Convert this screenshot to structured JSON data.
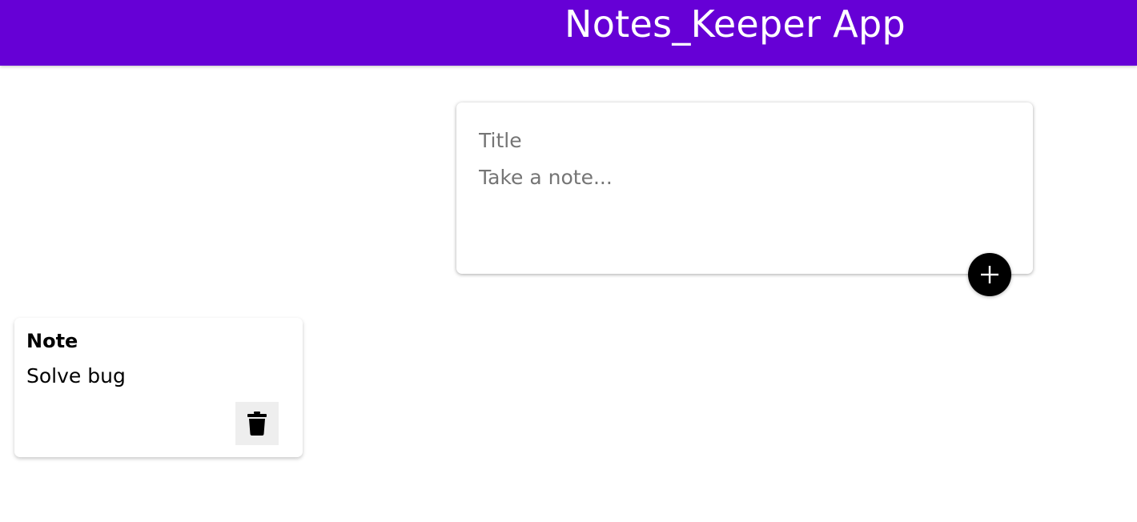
{
  "header": {
    "title": "Notes_Keeper App",
    "background_color": "#6600d6"
  },
  "create_note": {
    "title_placeholder": "Title",
    "content_placeholder": "Take a note...",
    "title_value": "",
    "content_value": "",
    "add_button_icon": "plus-icon"
  },
  "notes": [
    {
      "title": "Note",
      "content": "Solve bug",
      "delete_icon": "trash-icon"
    }
  ]
}
